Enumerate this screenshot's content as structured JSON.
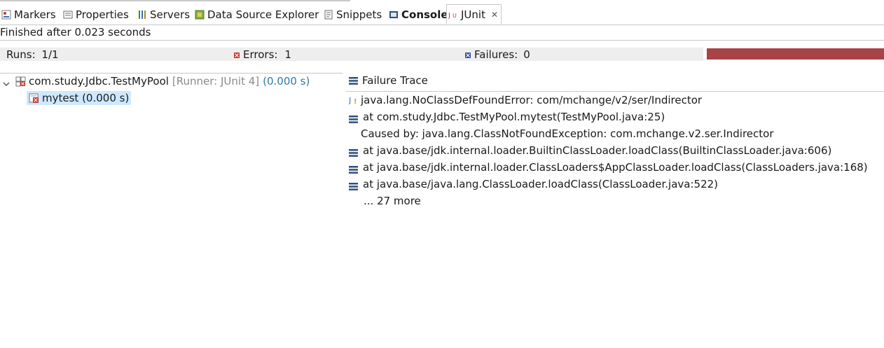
{
  "tabs": [
    {
      "label": "Markers",
      "icon": "markers-icon"
    },
    {
      "label": "Properties",
      "icon": "properties-icon"
    },
    {
      "label": "Servers",
      "icon": "servers-icon"
    },
    {
      "label": "Data Source Explorer",
      "icon": "data-source-explorer-icon"
    },
    {
      "label": "Snippets",
      "icon": "snippets-icon"
    },
    {
      "label": "Console",
      "icon": "console-icon"
    },
    {
      "label": "JUnit",
      "icon": "junit-icon"
    }
  ],
  "status_text": "Finished after 0.023 seconds",
  "counters": {
    "runs_label": "Runs:",
    "runs_value": "1/1",
    "errors_label": "Errors:",
    "errors_value": "1",
    "failures_label": "Failures:",
    "failures_value": "0",
    "progress_color": "#a84446",
    "progress_fraction": 1.0
  },
  "tree": {
    "suite_name": "com.study.Jdbc.TestMyPool",
    "suite_runner": "[Runner: JUnit 4]",
    "suite_time": "(0.000 s)",
    "test_label": "mytest (0.000 s)"
  },
  "trace": {
    "header": "Failure Trace",
    "lines": [
      "java.lang.NoClassDefFoundError: com/mchange/v2/ser/Indirector",
      "at com.study.Jdbc.TestMyPool.mytest(TestMyPool.java:25)",
      "Caused by: java.lang.ClassNotFoundException: com.mchange.v2.ser.Indirector",
      "at java.base/jdk.internal.loader.BuiltinClassLoader.loadClass(BuiltinClassLoader.java:606)",
      "at java.base/jdk.internal.loader.ClassLoaders$AppClassLoader.loadClass(ClassLoaders.java:168)",
      "at java.base/java.lang.ClassLoader.loadClass(ClassLoader.java:522)",
      "... 27 more"
    ]
  }
}
